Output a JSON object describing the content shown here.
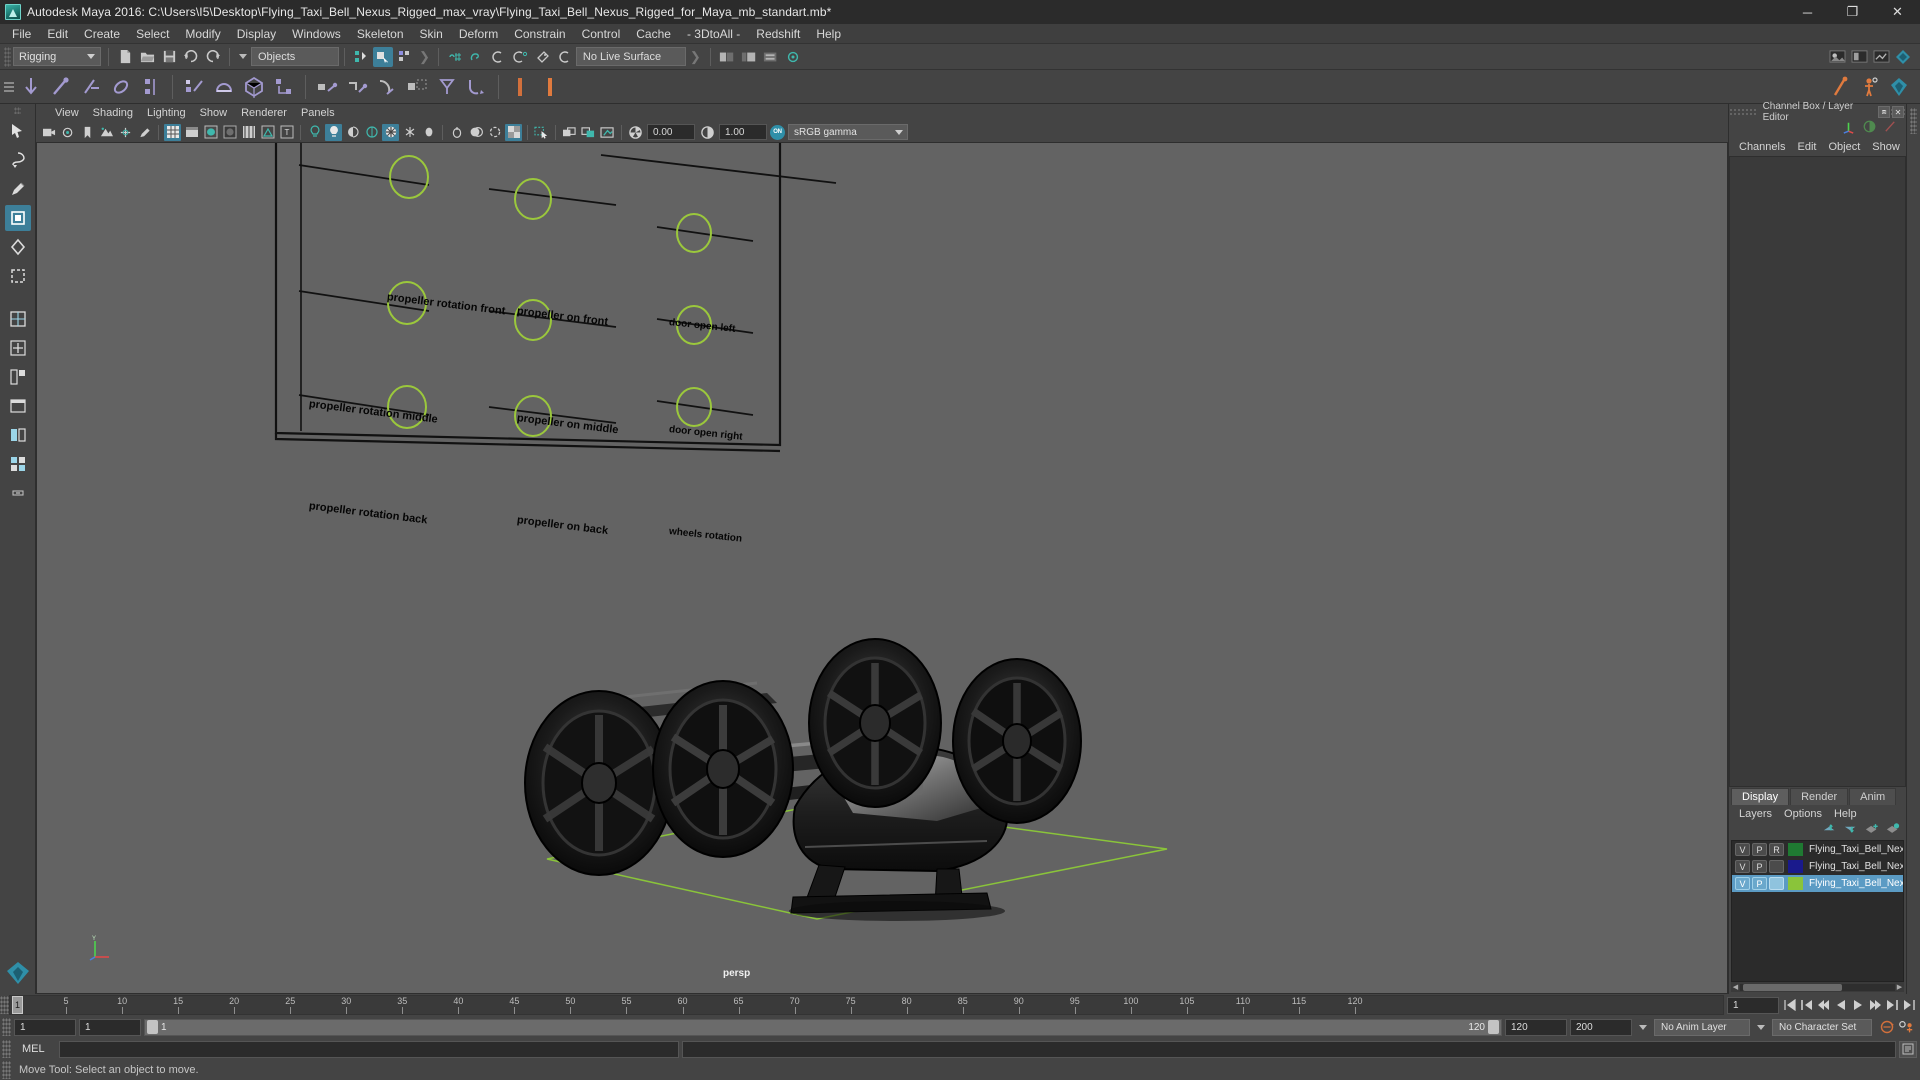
{
  "window": {
    "title": "Autodesk Maya 2016: C:\\Users\\I5\\Desktop\\Flying_Taxi_Bell_Nexus_Rigged_max_vray\\Flying_Taxi_Bell_Nexus_Rigged_for_Maya_mb_standart.mb*",
    "minimize": "─",
    "maximize": "❐",
    "close": "✕"
  },
  "menubar": {
    "items": [
      {
        "label": "File"
      },
      {
        "label": "Edit"
      },
      {
        "label": "Create"
      },
      {
        "label": "Select"
      },
      {
        "label": "Modify"
      },
      {
        "label": "Display"
      },
      {
        "label": "Windows"
      },
      {
        "label": "Skeleton"
      },
      {
        "label": "Skin"
      },
      {
        "label": "Deform"
      },
      {
        "label": "Constrain"
      },
      {
        "label": "Control"
      },
      {
        "label": "Cache"
      },
      {
        "label": "- 3DtoAll -"
      },
      {
        "label": "Redshift"
      },
      {
        "label": "Help"
      }
    ]
  },
  "statusline": {
    "menu_set": "Rigging",
    "selection_mask": "Objects",
    "live_surface": "No Live Surface"
  },
  "viewport_menu": {
    "items": [
      {
        "label": "View"
      },
      {
        "label": "Shading"
      },
      {
        "label": "Lighting"
      },
      {
        "label": "Show"
      },
      {
        "label": "Renderer"
      },
      {
        "label": "Panels"
      }
    ]
  },
  "viewport_toolbar": {
    "exposure": "0.00",
    "gamma": "1.00",
    "color_toggle": "ON",
    "view_transform": "sRGB gamma"
  },
  "viewport": {
    "camera_label": "persp",
    "rig_controls": [
      {
        "label": "propeller rotation front",
        "col": 0,
        "row": 0
      },
      {
        "label": "propeller rotation middle",
        "col": 0,
        "row": 1
      },
      {
        "label": "propeller rotation back",
        "col": 0,
        "row": 2
      },
      {
        "label": "propeller on front",
        "col": 1,
        "row": 0
      },
      {
        "label": "propeller on middle",
        "col": 1,
        "row": 1
      },
      {
        "label": "propeller on back",
        "col": 1,
        "row": 2
      },
      {
        "label": "door open left",
        "col": 2,
        "row": 0
      },
      {
        "label": "door open right",
        "col": 2,
        "row": 1
      },
      {
        "label": "wheels rotation",
        "col": 2,
        "row": 2
      }
    ],
    "control_color": "#9bc83c",
    "grid_color": "#8ac43a",
    "background_color": "#636363",
    "axis_labels": {
      "y": "Y",
      "x": "X",
      "z": "Z"
    }
  },
  "channel_box": {
    "panel_title": "Channel Box / Layer Editor",
    "menus": [
      {
        "label": "Channels"
      },
      {
        "label": "Edit"
      },
      {
        "label": "Object"
      },
      {
        "label": "Show"
      }
    ]
  },
  "layer_editor": {
    "tabs": [
      {
        "label": "Display",
        "active": true
      },
      {
        "label": "Render",
        "active": false
      },
      {
        "label": "Anim",
        "active": false
      }
    ],
    "menus": [
      {
        "label": "Layers"
      },
      {
        "label": "Options"
      },
      {
        "label": "Help"
      }
    ],
    "layers": [
      {
        "v": "V",
        "p": "P",
        "r": "R",
        "color": "#1f7a32",
        "name": "Flying_Taxi_Bell_Nexus",
        "selected": false
      },
      {
        "v": "V",
        "p": "P",
        "r": "",
        "color": "#1a1a8c",
        "name": "Flying_Taxi_Bell_Nexus",
        "selected": false
      },
      {
        "v": "V",
        "p": "P",
        "r": "",
        "color": "#8ac43a",
        "name": "Flying_Taxi_Bell_Nexus",
        "selected": true
      }
    ]
  },
  "timeline": {
    "start_frame": "1",
    "end_frame": "120",
    "current_frame": "1",
    "ticks": [
      {
        "value": "5"
      },
      {
        "value": "10"
      },
      {
        "value": "15"
      },
      {
        "value": "20"
      },
      {
        "value": "25"
      },
      {
        "value": "30"
      },
      {
        "value": "35"
      },
      {
        "value": "40"
      },
      {
        "value": "45"
      },
      {
        "value": "50"
      },
      {
        "value": "55"
      },
      {
        "value": "60"
      },
      {
        "value": "65"
      },
      {
        "value": "70"
      },
      {
        "value": "75"
      },
      {
        "value": "80"
      },
      {
        "value": "85"
      },
      {
        "value": "90"
      },
      {
        "value": "95"
      },
      {
        "value": "100"
      },
      {
        "value": "105"
      },
      {
        "value": "110"
      },
      {
        "value": "115"
      },
      {
        "value": "120"
      }
    ],
    "playback_field": "1"
  },
  "range_slider": {
    "anim_start": "1",
    "range_start": "1",
    "bar_start": "1",
    "bar_end": "120",
    "range_end": "120",
    "anim_end": "200",
    "anim_layer": "No Anim Layer",
    "character_set": "No Character Set"
  },
  "command_line": {
    "label": "MEL",
    "input_value": "",
    "output_value": ""
  },
  "status_bar": {
    "help_text": "Move Tool: Select an object to move."
  }
}
